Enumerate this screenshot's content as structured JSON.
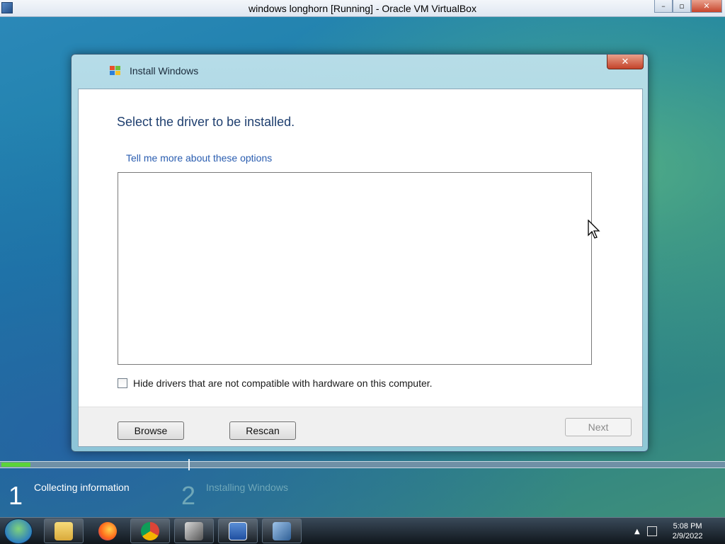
{
  "host_window": {
    "title": "windows longhorn [Running] - Oracle VM VirtualBox",
    "controls": {
      "minimize": "–",
      "restore": "▫",
      "close": "✕"
    }
  },
  "dialog": {
    "title": "Install Windows",
    "close_label": "✕",
    "heading": "Select the driver to be installed.",
    "more_link": "Tell me more about these options",
    "driver_list_items": [],
    "hide_incompatible": {
      "label": "Hide drivers that are not compatible with hardware on this computer.",
      "checked": false
    },
    "buttons": {
      "browse": "Browse",
      "rescan": "Rescan",
      "next": "Next"
    }
  },
  "setup_progress": {
    "progress_fraction": 0.04,
    "steps": [
      {
        "number": "1",
        "label": "Collecting information",
        "active": true
      },
      {
        "number": "2",
        "label": "Installing Windows",
        "active": false
      }
    ]
  },
  "taskbar": {
    "apps": [
      "explorer",
      "firefox",
      "chrome",
      "app-icon",
      "word",
      "virtualbox"
    ],
    "tray": {
      "expand": "▲",
      "time": "5:08 PM",
      "date": "2/9/2022"
    }
  },
  "colors": {
    "heading": "#1f3f6f",
    "link": "#2a5db0",
    "progress": "#5bd33a",
    "step_active": "#ffffff",
    "step_inactive": "#6fa7b8"
  }
}
